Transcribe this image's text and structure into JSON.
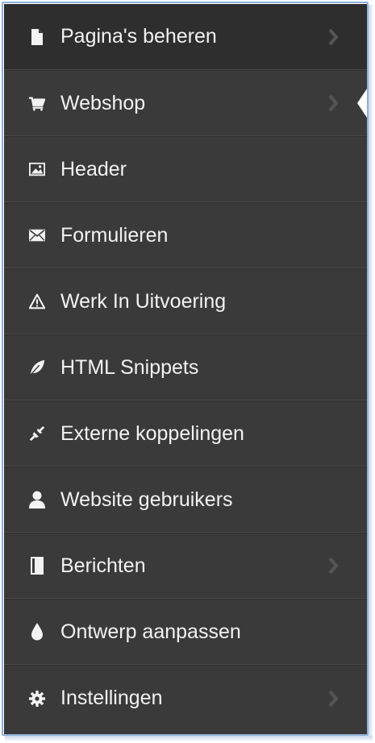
{
  "menu": {
    "items": [
      {
        "label": "Pagina's beheren",
        "icon": "file-icon",
        "has_submenu": true
      },
      {
        "label": "Webshop",
        "icon": "cart-icon",
        "has_submenu": true,
        "active": true
      },
      {
        "label": "Header",
        "icon": "image-icon",
        "has_submenu": false
      },
      {
        "label": "Formulieren",
        "icon": "envelope-icon",
        "has_submenu": false
      },
      {
        "label": "Werk In Uitvoering",
        "icon": "warning-icon",
        "has_submenu": false
      },
      {
        "label": "HTML Snippets",
        "icon": "leaf-icon",
        "has_submenu": false
      },
      {
        "label": "Externe koppelingen",
        "icon": "link-icon",
        "has_submenu": false
      },
      {
        "label": "Website gebruikers",
        "icon": "user-icon",
        "has_submenu": false
      },
      {
        "label": "Berichten",
        "icon": "book-icon",
        "has_submenu": true
      },
      {
        "label": "Ontwerp aanpassen",
        "icon": "drop-icon",
        "has_submenu": false
      },
      {
        "label": "Instellingen",
        "icon": "gear-icon",
        "has_submenu": true
      }
    ]
  },
  "colors": {
    "menu_bg": "#3a3a3a",
    "menu_top_item_bg": "#2e2e2e",
    "text": "#f2f2f2",
    "chevron": "#5a5a5a",
    "border_accent": "#8fb0d8"
  }
}
